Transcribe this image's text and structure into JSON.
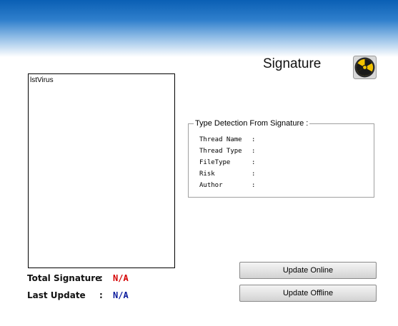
{
  "header": {
    "title": "Signature",
    "icon": "radiation-hazard-icon"
  },
  "virus_list": {
    "label": "lstVirus"
  },
  "detection": {
    "legend": "Type Detection From Signature :",
    "rows": [
      {
        "label": "Thread Name",
        "colon": ":"
      },
      {
        "label": "Thread Type",
        "colon": ":"
      },
      {
        "label": "FileType",
        "colon": ":"
      },
      {
        "label": "Risk",
        "colon": ":"
      },
      {
        "label": "Author",
        "colon": ":"
      }
    ]
  },
  "stats": {
    "total_signature": {
      "label": "Total Signature",
      "colon": ":",
      "value": "N/A",
      "color": "#d40000"
    },
    "last_update": {
      "label": "Last Update",
      "colon": ":",
      "value": "N/A",
      "color": "#0a1a9c"
    }
  },
  "buttons": {
    "update_online": "Update Online",
    "update_offline": "Update Offline"
  }
}
